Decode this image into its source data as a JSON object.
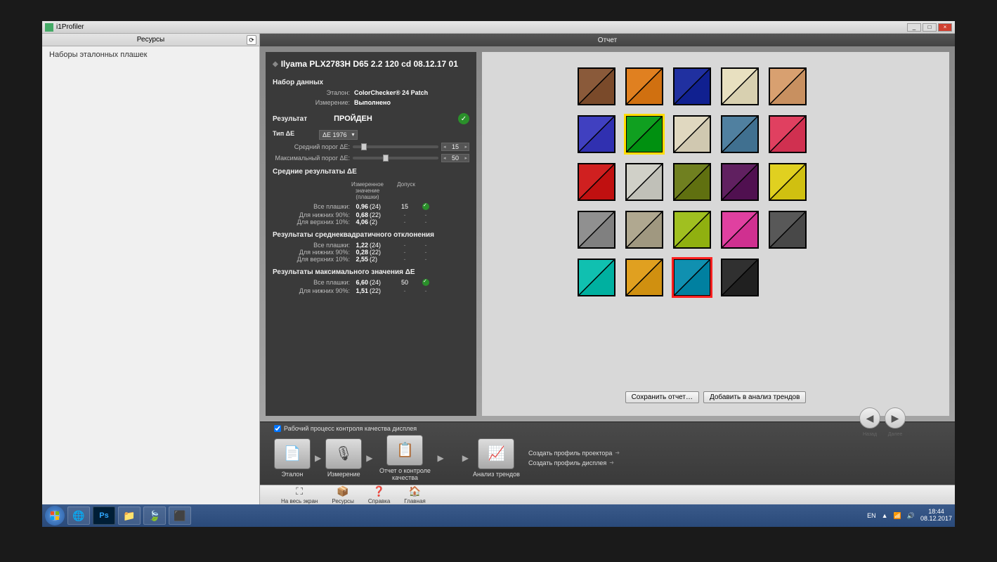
{
  "window": {
    "title": "i1Profiler"
  },
  "sidebar": {
    "header": "Ресурсы",
    "item": "Наборы эталонных плашек"
  },
  "main_header": "Отчет",
  "profile_title": "Ilyama PLX2783H D65 2.2 120 cd 08.12.17 01",
  "dataset": {
    "header": "Набор данных",
    "etalon_label": "Эталон:",
    "etalon_value": "ColorChecker® 24 Patch",
    "measure_label": "Измерение:",
    "measure_value": "Выполнено"
  },
  "result": {
    "label": "Результат",
    "value": "ПРОЙДЕН"
  },
  "de_type": {
    "label": "Тип ΔE",
    "value": "ΔE 1976"
  },
  "thresholds": {
    "avg_label": "Средний порог ΔE:",
    "avg_value": "15",
    "max_label": "Максимальный порог ΔE:",
    "max_value": "50"
  },
  "avg_results": {
    "header": "Средние результаты ΔE",
    "col_measured": "Измеренное значение (плашки)",
    "col_tolerance": "Допуск",
    "rows": [
      {
        "label": "Все плашки:",
        "value": "0,96",
        "count": "(24)",
        "tol": "15",
        "pass": true
      },
      {
        "label": "Для нижних 90%:",
        "value": "0,68",
        "count": "(22)",
        "tol": "-",
        "pass": false
      },
      {
        "label": "Для верхних 10%:",
        "value": "4,06",
        "count": "(2)",
        "tol": "-",
        "pass": false
      }
    ]
  },
  "std_results": {
    "header": "Результаты среднеквадратичного отклонения",
    "rows": [
      {
        "label": "Все плашки:",
        "value": "1,22",
        "count": "(24)",
        "tol": "-",
        "pass": false
      },
      {
        "label": "Для нижних 90%:",
        "value": "0,28",
        "count": "(22)",
        "tol": "-",
        "pass": false
      },
      {
        "label": "Для верхних 10%:",
        "value": "2,55",
        "count": "(2)",
        "tol": "-",
        "pass": false
      }
    ]
  },
  "max_results": {
    "header": "Результаты максимального значения ΔE",
    "rows": [
      {
        "label": "Все плашки:",
        "value": "6,60",
        "count": "(24)",
        "tol": "50",
        "pass": true
      },
      {
        "label": "Для нижних 90%:",
        "value": "1,51",
        "count": "(22)",
        "tol": "-",
        "pass": false
      }
    ]
  },
  "patches": [
    {
      "c1": "#8a5a3a",
      "c2": "#7a4a2a"
    },
    {
      "c1": "#e08020",
      "c2": "#d07010"
    },
    {
      "c1": "#2030a0",
      "c2": "#102090"
    },
    {
      "c1": "#e8e0c0",
      "c2": "#d8d0b0"
    },
    {
      "c1": "#d8a070",
      "c2": "#c89060"
    },
    {
      "c1": "#00000000",
      "c2": "#00000000",
      "empty": true
    },
    {
      "c1": "#4040c0",
      "c2": "#3030b0"
    },
    {
      "c1": "#10a020",
      "c2": "#009010",
      "best": true
    },
    {
      "c1": "#e0d8c0",
      "c2": "#d0c8b0"
    },
    {
      "c1": "#5080a0",
      "c2": "#407090"
    },
    {
      "c1": "#e04060",
      "c2": "#d03050"
    },
    {
      "c1": "#00000000",
      "c2": "#00000000",
      "empty": true
    },
    {
      "c1": "#d02020",
      "c2": "#c01010"
    },
    {
      "c1": "#d0d0c8",
      "c2": "#c0c0b8"
    },
    {
      "c1": "#708020",
      "c2": "#607010"
    },
    {
      "c1": "#602060",
      "c2": "#501050"
    },
    {
      "c1": "#e0d020",
      "c2": "#d0c010"
    },
    {
      "c1": "#00000000",
      "c2": "#00000000",
      "empty": true
    },
    {
      "c1": "#909090",
      "c2": "#808080"
    },
    {
      "c1": "#b0a890",
      "c2": "#a09880"
    },
    {
      "c1": "#a0c020",
      "c2": "#90b010"
    },
    {
      "c1": "#e040a0",
      "c2": "#d03090"
    },
    {
      "c1": "#585858",
      "c2": "#484848"
    },
    {
      "c1": "#00000000",
      "c2": "#00000000",
      "empty": true
    },
    {
      "c1": "#10c0b0",
      "c2": "#00b0a0"
    },
    {
      "c1": "#e0a020",
      "c2": "#d09010"
    },
    {
      "c1": "#1090b0",
      "c2": "#0080a0",
      "worst": true
    },
    {
      "c1": "#303030",
      "c2": "#202020"
    },
    {
      "c1": "#00000000",
      "c2": "#00000000",
      "empty": true
    },
    {
      "c1": "#00000000",
      "c2": "#00000000",
      "empty": true
    }
  ],
  "report_buttons": {
    "save": "Сохранить отчет…",
    "add": "Добавить в анализ трендов"
  },
  "nav": {
    "back": "Назад",
    "next": "Далее"
  },
  "workflow": {
    "checkbox": "Рабочий процесс контроля качества дисплея",
    "steps": [
      {
        "label": "Эталон"
      },
      {
        "label": "Измерение"
      },
      {
        "label": "Отчет о контроле качества"
      },
      {
        "label": "Анализ трендов"
      }
    ],
    "links": [
      "Создать профиль проектора",
      "Создать профиль дисплея"
    ]
  },
  "bottom_toolbar": [
    {
      "label": "На весь экран"
    },
    {
      "label": "Ресурсы"
    },
    {
      "label": "Справка"
    },
    {
      "label": "Главная"
    }
  ],
  "tray": {
    "lang": "EN",
    "time": "18:44",
    "date": "08.12.2017"
  }
}
